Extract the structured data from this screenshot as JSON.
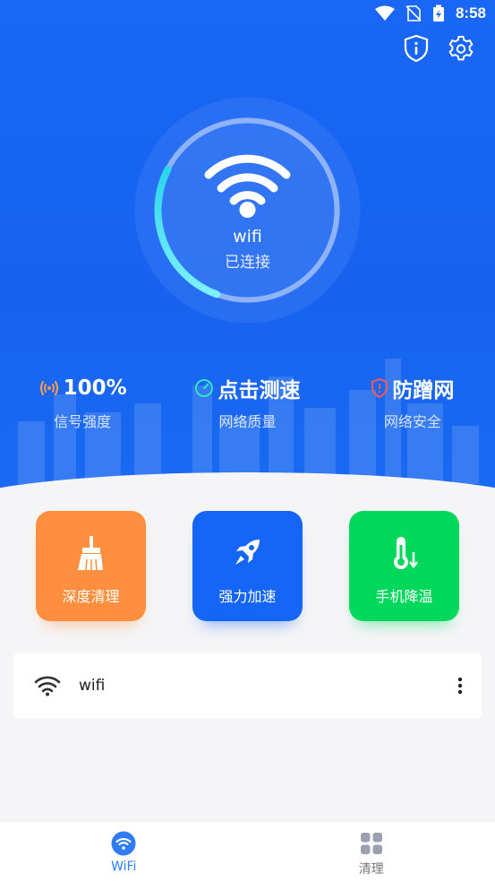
{
  "status_bar": {
    "time": "8:58"
  },
  "header": {
    "info_icon": "shield-info-icon",
    "settings_icon": "gear-icon"
  },
  "connection": {
    "name": "wifi",
    "status": "已连接",
    "progress_fraction": 0.27
  },
  "stats": [
    {
      "value": "100%",
      "label": "信号强度",
      "icon": "signal-icon",
      "icon_color": "#ff9a4a"
    },
    {
      "value": "点击测速",
      "label": "网络质量",
      "icon": "speedometer-icon",
      "icon_color": "#2fe3c8"
    },
    {
      "value": "防蹭网",
      "label": "网络安全",
      "icon": "shield-alert-icon",
      "icon_color": "#ff5a5a"
    }
  ],
  "tiles": [
    {
      "label": "深度清理",
      "icon": "broom-icon",
      "color": "#ff8f3e"
    },
    {
      "label": "强力加速",
      "icon": "rocket-icon",
      "color": "#1565f7"
    },
    {
      "label": "手机降温",
      "icon": "thermometer-icon",
      "color": "#00d85c"
    }
  ],
  "wifi_list": [
    {
      "name": "wifi"
    }
  ],
  "bottom_nav": [
    {
      "label": "WiFi",
      "active": true,
      "color": "#2f7cf6"
    },
    {
      "label": "清理",
      "active": false,
      "color": "#9aa0b0"
    }
  ]
}
